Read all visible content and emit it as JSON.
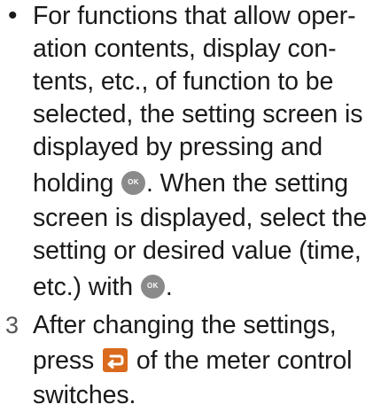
{
  "bullet_item": {
    "marker": "•",
    "lines": [
      "For functions that allow oper-",
      "ation contents, display con-",
      "tents, etc., of function to be",
      "selected, the setting screen is",
      "displayed by pressing and",
      "holding",
      ". When the setting",
      "screen is displayed, select the",
      "setting or desired value (time,",
      "etc.) with",
      "."
    ]
  },
  "step_item": {
    "number": "3",
    "lines": [
      "After changing the settings,",
      "press",
      "of the meter control",
      "switches."
    ]
  },
  "icons": {
    "ok_button": "ok-button-icon",
    "ok_label": "OK",
    "back_button": "back-button-icon",
    "back_color": "#d96a1e",
    "ok_color": "#8a8a8a"
  }
}
